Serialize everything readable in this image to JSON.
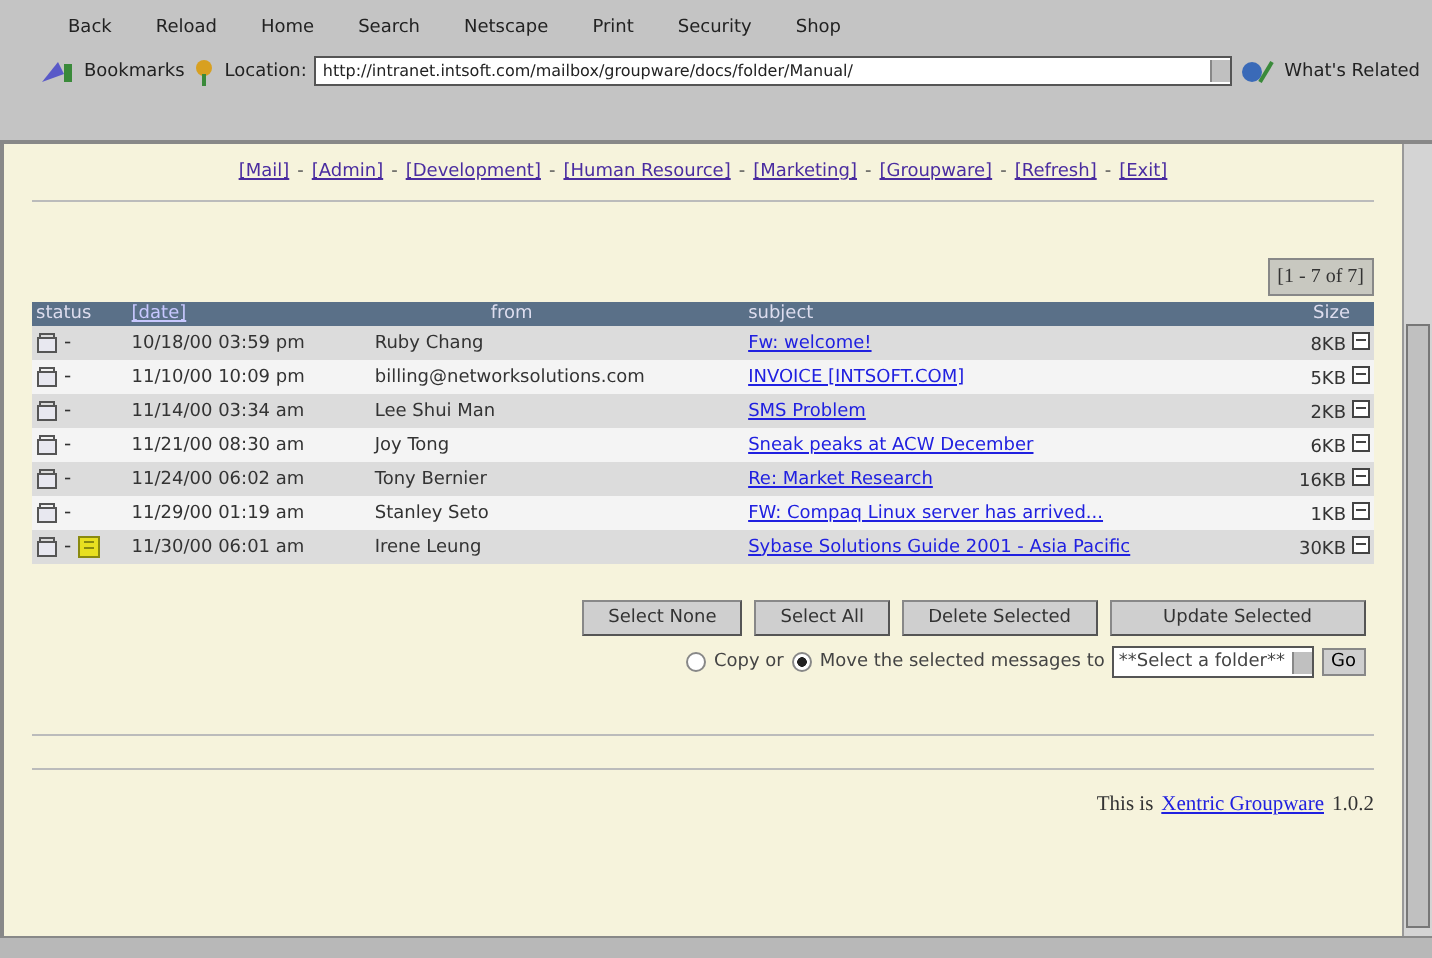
{
  "toolbar": {
    "buttons": [
      "Back",
      "Reload",
      "Home",
      "Search",
      "Netscape",
      "Print",
      "Security",
      "Shop"
    ]
  },
  "location_bar": {
    "bookmarks": "Bookmarks",
    "label": "Location:",
    "url": "http://intranet.intsoft.com/mailbox/groupware/docs/folder/Manual/",
    "related": "What's Related"
  },
  "nav_links": [
    {
      "label": "[Mail]"
    },
    {
      "sep": "-",
      "label": "[Admin]"
    },
    {
      "sep": "-",
      "label": "[Development]"
    },
    {
      "sep": "-",
      "label": "[Human Resource]"
    },
    {
      "sep": "-",
      "label": "[Marketing]"
    },
    {
      "sep": "-",
      "label": "[Groupware]"
    },
    {
      "sep": "-",
      "label": "[Refresh]"
    },
    {
      "sep": "-",
      "label": "[Exit]"
    }
  ],
  "pager": "[1 - 7 of 7]",
  "table": {
    "columns": [
      "status",
      "[date]",
      "from",
      "subject",
      "Size"
    ],
    "rows": [
      {
        "dash": "-",
        "note": false,
        "date": "10/18/00 03:59 pm",
        "from": "Ruby Chang",
        "subject": "Fw: welcome!",
        "size": "8KB"
      },
      {
        "dash": "-",
        "note": false,
        "date": "11/10/00 10:09 pm",
        "from": "billing@networksolutions.com",
        "subject": "INVOICE [INTSOFT.COM]",
        "size": "5KB"
      },
      {
        "dash": "-",
        "note": false,
        "date": "11/14/00 03:34 am",
        "from": "Lee Shui Man",
        "subject": "SMS Problem",
        "size": "2KB"
      },
      {
        "dash": "-",
        "note": false,
        "date": "11/21/00 08:30 am",
        "from": "Joy Tong",
        "subject": "Sneak peaks at ACW December",
        "size": "6KB"
      },
      {
        "dash": "-",
        "note": false,
        "date": "11/24/00 06:02 am",
        "from": "Tony Bernier",
        "subject": "Re: Market Research",
        "size": "16KB"
      },
      {
        "dash": "-",
        "note": false,
        "date": "11/29/00 01:19 am",
        "from": "Stanley Seto",
        "subject": "FW: Compaq Linux server has arrived...",
        "size": "1KB"
      },
      {
        "dash": "-",
        "note": true,
        "date": "11/30/00 06:01 am",
        "from": "Irene Leung",
        "subject": "Sybase Solutions Guide 2001 - Asia Pacific",
        "size": "30KB"
      }
    ]
  },
  "actions": [
    "Select None",
    "Select All",
    "Delete Selected",
    "Update Selected"
  ],
  "move": {
    "options": [
      {
        "label": "Copy or",
        "selected": false
      },
      {
        "label": "Move the selected messages to",
        "selected": true
      }
    ],
    "folder": "**Select a folder**",
    "go": "Go"
  },
  "footer": {
    "prefix": "This is",
    "link": "Xentric Groupware",
    "version": "1.0.2"
  }
}
